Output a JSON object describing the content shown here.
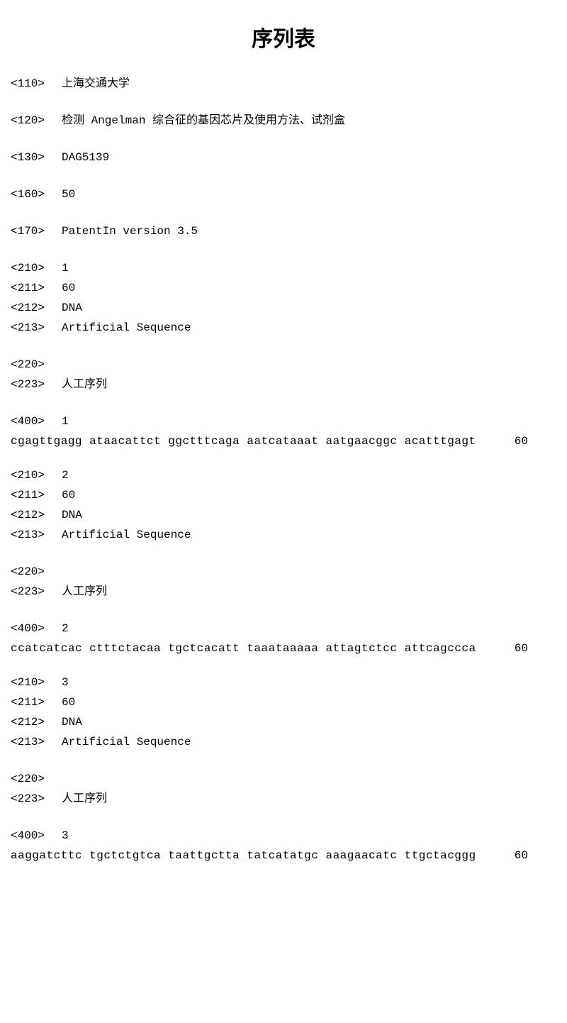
{
  "title": "序列表",
  "header": {
    "tag_110": "<110>",
    "val_110": "上海交通大学",
    "tag_120": "<120>",
    "val_120": "检测 Angelman 综合征的基因芯片及使用方法、试剂盒",
    "tag_130": "<130>",
    "val_130": "DAG5139",
    "tag_160": "<160>",
    "val_160": "50",
    "tag_170": "<170>",
    "val_170": "PatentIn version 3.5"
  },
  "sequences": [
    {
      "tag_210": "<210>",
      "val_210": "1",
      "tag_211": "<211>",
      "val_211": "60",
      "tag_212": "<212>",
      "val_212": "DNA",
      "tag_213": "<213>",
      "val_213": "Artificial Sequence",
      "tag_220": "<220>",
      "val_220": "",
      "tag_223": "<223>",
      "val_223": "人工序列",
      "tag_400": "<400>",
      "val_400": "1",
      "seq": "cgagttgagg ataacattct ggctttcaga aatcataaat aatgaacggc acatttgagt",
      "seq_num": "60"
    },
    {
      "tag_210": "<210>",
      "val_210": "2",
      "tag_211": "<211>",
      "val_211": "60",
      "tag_212": "<212>",
      "val_212": "DNA",
      "tag_213": "<213>",
      "val_213": "Artificial Sequence",
      "tag_220": "<220>",
      "val_220": "",
      "tag_223": "<223>",
      "val_223": "人工序列",
      "tag_400": "<400>",
      "val_400": "2",
      "seq": "ccatcatcac ctttctacaa tgctcacatt taaataaaaa attagtctcc attcagccca",
      "seq_num": "60"
    },
    {
      "tag_210": "<210>",
      "val_210": "3",
      "tag_211": "<211>",
      "val_211": "60",
      "tag_212": "<212>",
      "val_212": "DNA",
      "tag_213": "<213>",
      "val_213": "Artificial Sequence",
      "tag_220": "<220>",
      "val_220": "",
      "tag_223": "<223>",
      "val_223": "人工序列",
      "tag_400": "<400>",
      "val_400": "3",
      "seq": "aaggatcttc tgctctgtca taattgctta tatcatatgc aaagaacatc ttgctacggg",
      "seq_num": "60"
    }
  ]
}
